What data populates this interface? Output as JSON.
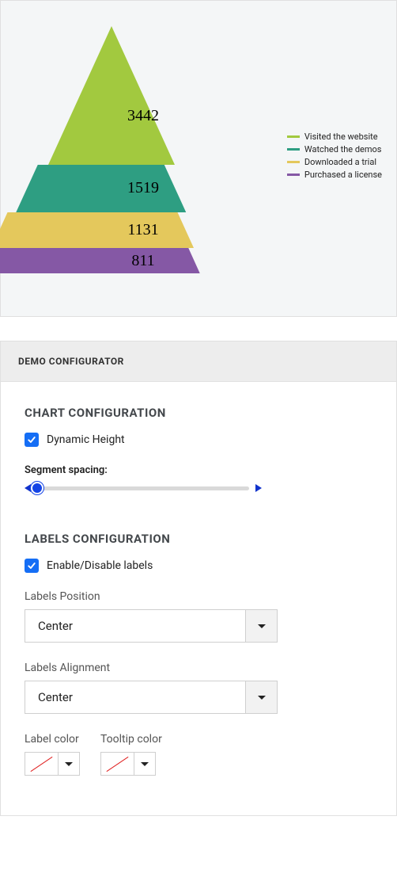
{
  "chart_data": {
    "type": "funnel",
    "series": [
      {
        "name": "Visited the website",
        "value": 3442,
        "color": "#a2c93f"
      },
      {
        "name": "Watched the demos",
        "value": 1519,
        "color": "#2e9e82"
      },
      {
        "name": "Downloaded a trial",
        "value": 1131,
        "color": "#e4c85c"
      },
      {
        "name": "Purchased a license",
        "value": 811,
        "color": "#8558a5"
      }
    ]
  },
  "config": {
    "header": "DEMO CONFIGURATOR",
    "chart_section_title": "CHART CONFIGURATION",
    "dynamic_height_label": "Dynamic Height",
    "dynamic_height_checked": true,
    "segment_spacing_label": "Segment spacing:",
    "labels_section_title": "LABELS CONFIGURATION",
    "enable_labels_label": "Enable/Disable labels",
    "enable_labels_checked": true,
    "labels_position_label": "Labels Position",
    "labels_position_value": "Center",
    "labels_alignment_label": "Labels Alignment",
    "labels_alignment_value": "Center",
    "label_color_label": "Label color",
    "tooltip_color_label": "Tooltip color"
  }
}
